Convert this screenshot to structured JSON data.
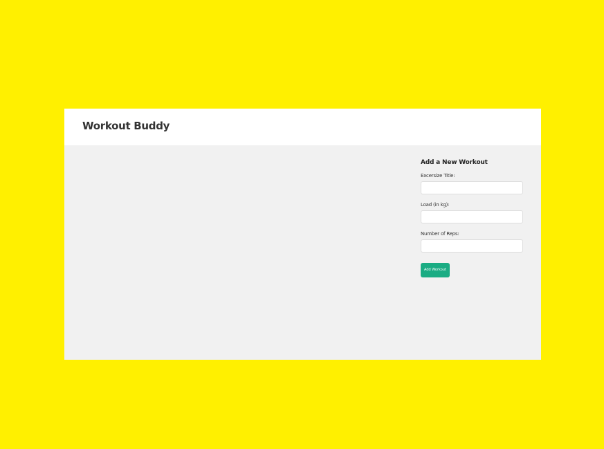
{
  "header": {
    "title": "Workout Buddy"
  },
  "form": {
    "heading": "Add a New Workout",
    "fields": [
      {
        "label": "Excersize Title:",
        "value": ""
      },
      {
        "label": "Load (in kg):",
        "value": ""
      },
      {
        "label": "Number of Reps:",
        "value": ""
      }
    ],
    "submit_label": "Add Workout"
  },
  "colors": {
    "page_background": "#fff000",
    "header_background": "#ffffff",
    "content_background": "#f1f1f1",
    "accent": "#1aac83"
  }
}
